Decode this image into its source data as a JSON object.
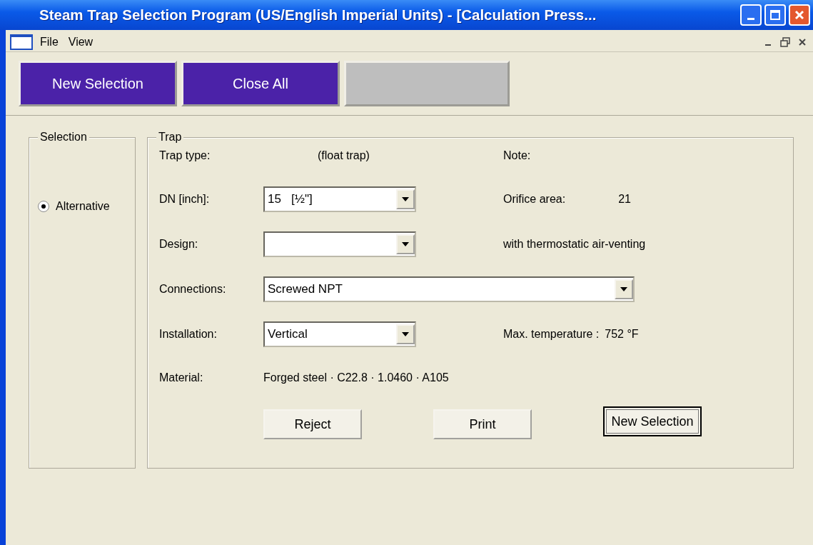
{
  "window": {
    "title": "Steam Trap Selection Program (US/English Imperial Units) - [Calculation Press..."
  },
  "menu": [
    {
      "label": "File"
    },
    {
      "label": "View"
    }
  ],
  "toolbar": [
    {
      "label": "New Selection",
      "disabled": false
    },
    {
      "label": "Close All",
      "disabled": false
    },
    {
      "disabled": true
    }
  ],
  "selection_group": {
    "title": "Selection",
    "options": [
      {
        "label": "Alternative",
        "selected": true
      }
    ]
  },
  "trap_group": {
    "title": "Trap",
    "trap_type": {
      "label": "Trap type:",
      "value": "(float trap)"
    },
    "note": {
      "label": "Note:"
    },
    "fields": [
      {
        "label": "DN [inch]:",
        "value": "15   [½\"]",
        "side": {
          "label": "Orifice area:",
          "value": "21"
        }
      },
      {
        "label": "Design:",
        "side": {
          "label": "with thermostatic air-venting"
        }
      },
      {
        "label": "Connections:",
        "value": "Screwed NPT"
      },
      {
        "label": "Installation:",
        "value": "Vertical",
        "side": {
          "label": "Max. temperature :",
          "value": "752 °F"
        }
      }
    ],
    "material": {
      "label": "Material:",
      "value": "Forged steel · C22.8 · 1.0460 · A105"
    },
    "buttons": [
      {
        "label": "Reject",
        "focused": false
      },
      {
        "label": "Print",
        "focused": false
      },
      {
        "label": "New Selection",
        "focused": true
      }
    ]
  }
}
